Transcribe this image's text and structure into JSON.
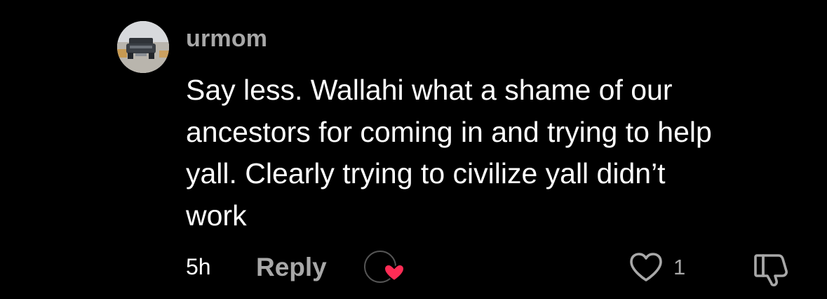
{
  "comment": {
    "username": "urmom",
    "text": "Say less. Wallahi what a shame of our\nancestors for coming in and trying to help\nyall. Clearly trying to civilize yall didn’t\nwork",
    "timestamp": "5h",
    "reply_label": "Reply",
    "like_count": "1"
  },
  "icons": {
    "avatar": "car-photo-avatar",
    "creator_like": "creator-liked-heart-icon",
    "like": "heart-outline-icon",
    "dislike": "thumbs-down-icon"
  },
  "colors": {
    "background": "#000000",
    "primary_text": "#ffffff",
    "secondary_text": "#a8a8a8",
    "heart_accent": "#fe2c55"
  }
}
